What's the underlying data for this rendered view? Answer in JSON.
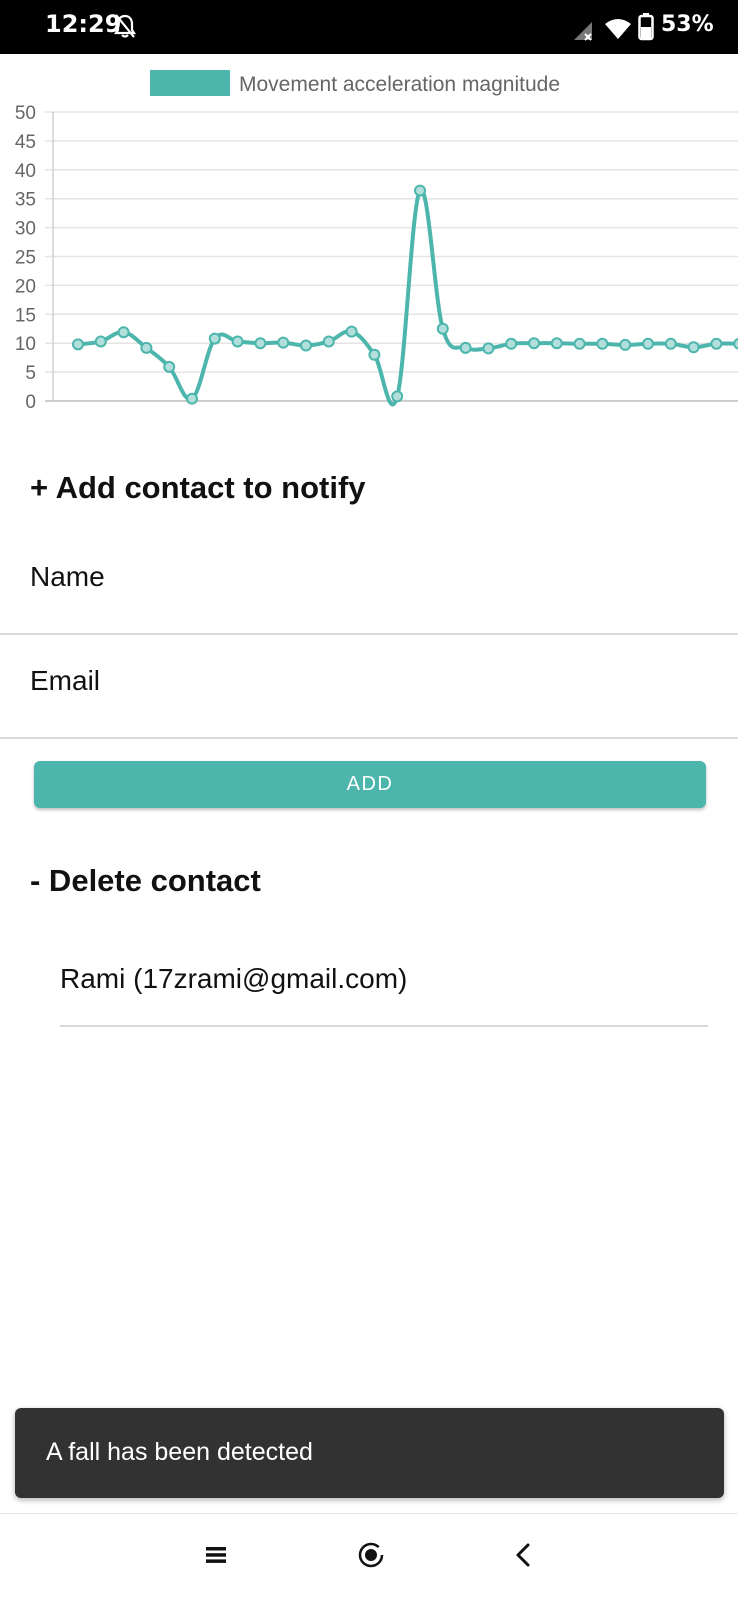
{
  "status_bar": {
    "time": "12:29",
    "battery": "53%",
    "icons": [
      "bell-off-icon",
      "signal-icon",
      "wifi-icon",
      "battery-icon"
    ]
  },
  "chart_data": {
    "type": "line",
    "legend": [
      "Movement acceleration magnitude"
    ],
    "legend_position": "top",
    "ylim": [
      0,
      50
    ],
    "y_ticks": [
      "0",
      "5",
      "10",
      "15",
      "20",
      "25",
      "30",
      "35",
      "40",
      "45",
      "50"
    ],
    "grid": true,
    "series": [
      {
        "name": "Movement acceleration magnitude",
        "color": "#4db6ac",
        "values": [
          9.8,
          10.3,
          11.9,
          9.2,
          5.9,
          0.4,
          10.8,
          10.3,
          10.0,
          10.1,
          9.6,
          10.3,
          12.0,
          8.0,
          0.8,
          36.4,
          12.5,
          9.2,
          9.1,
          9.9,
          10.0,
          10.0,
          9.9,
          9.9,
          9.7,
          9.9,
          9.9,
          9.3,
          9.9,
          9.9
        ]
      }
    ]
  },
  "add_section": {
    "title": "+ Add contact to notify",
    "name_placeholder": "Name",
    "email_placeholder": "Email",
    "add_label": "ADD"
  },
  "delete_section": {
    "title": "- Delete contact",
    "contacts": [
      "Rami (17zrami@gmail.com)"
    ]
  },
  "snackbar": {
    "message": "A fall has been detected"
  },
  "nav_bar": {
    "buttons": [
      "recents-icon",
      "home-icon",
      "back-icon"
    ]
  },
  "colors": {
    "accent": "#4db6ac",
    "snackbar": "#323232",
    "status_bar": "#000000"
  }
}
